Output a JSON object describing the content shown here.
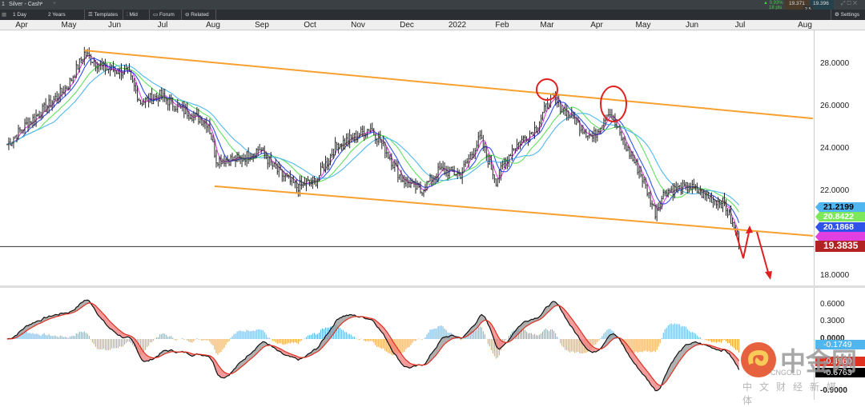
{
  "window": {
    "tab_number": "1",
    "title": "Silver - Cash",
    "quote": {
      "change_pct": "▲ 0.93%",
      "change_pts": "18 pts",
      "bid": "19.371",
      "ask": "19.396",
      "spread": "2.5"
    }
  },
  "toolbar": {
    "interval": "1 Day",
    "range": "2 Years",
    "templates": "Templates",
    "mid": "Mid",
    "forum": "Forum",
    "related": "Related",
    "settings": "Settings"
  },
  "colors": {
    "up_channel": "#f7a030",
    "price_line": "#b22222",
    "ma_fast": "#e040e0",
    "ma_mid": "#3050f0",
    "ma_slow": "#60e060",
    "ma_slower": "#50b8f0",
    "annotation": "#e02020"
  },
  "chart_data": [
    {
      "type": "candlestick",
      "title": "Silver - Cash",
      "x_ticks": [
        "Apr",
        "May",
        "Jun",
        "Jul",
        "Aug",
        "Sep",
        "Oct",
        "Nov",
        "Dec",
        "2022",
        "Feb",
        "Mar",
        "Apr",
        "May",
        "Jun",
        "Jul",
        "Aug"
      ],
      "y_ticks": [
        "28.0000",
        "26.0000",
        "24.0000",
        "22.0000",
        "18.0000"
      ],
      "ylim": [
        17.3,
        29.6
      ],
      "price_path": [
        [
          "2021-03-23",
          24.2
        ],
        [
          "2021-04-02",
          25.0
        ],
        [
          "2021-04-17",
          26.0
        ],
        [
          "2021-04-30",
          27.0
        ],
        [
          "2021-05-10",
          28.5
        ],
        [
          "2021-05-22",
          27.8
        ],
        [
          "2021-06-06",
          27.6
        ],
        [
          "2021-06-14",
          26.2
        ],
        [
          "2021-06-26",
          26.5
        ],
        [
          "2021-07-11",
          25.8
        ],
        [
          "2021-07-26",
          25.2
        ],
        [
          "2021-07-31",
          23.5
        ],
        [
          "2021-08-15",
          23.5
        ],
        [
          "2021-08-27",
          24.0
        ],
        [
          "2021-09-06",
          23.0
        ],
        [
          "2021-09-19",
          22.2
        ],
        [
          "2021-10-01",
          22.5
        ],
        [
          "2021-10-14",
          24.2
        ],
        [
          "2021-10-24",
          24.5
        ],
        [
          "2021-11-04",
          25.0
        ],
        [
          "2021-11-13",
          24.0
        ],
        [
          "2021-11-23",
          22.6
        ],
        [
          "2021-12-05",
          22.0
        ],
        [
          "2021-12-17",
          23.0
        ],
        [
          "2021-12-30",
          22.8
        ],
        [
          "2022-01-11",
          24.5
        ],
        [
          "2022-01-21",
          22.5
        ],
        [
          "2022-01-31",
          24.0
        ],
        [
          "2022-02-15",
          25.0
        ],
        [
          "2022-02-24",
          26.4
        ],
        [
          "2022-03-05",
          25.8
        ],
        [
          "2022-03-22",
          24.5
        ],
        [
          "2022-04-01",
          25.8
        ],
        [
          "2022-04-11",
          24.2
        ],
        [
          "2022-04-21",
          22.8
        ],
        [
          "2022-04-30",
          21.0
        ],
        [
          "2022-05-06",
          22.0
        ],
        [
          "2022-05-21",
          22.2
        ],
        [
          "2022-05-31",
          21.8
        ],
        [
          "2022-06-12",
          21.4
        ],
        [
          "2022-06-22",
          19.4
        ]
      ],
      "channel_upper": [
        [
          "2021-05-10",
          28.64
        ],
        [
          "2022-08-06",
          25.43
        ]
      ],
      "channel_lower": [
        [
          "2021-07-30",
          22.23
        ],
        [
          "2022-08-06",
          19.89
        ]
      ],
      "last_price": "19.3835",
      "ma_labels": [
        "21.2199",
        "20.8422",
        "20.1868"
      ],
      "annotations": [
        "circle at Mar 2022 high",
        "circle at Apr 2022 high",
        "red arrow up then down projection"
      ]
    },
    {
      "type": "macd",
      "y_ticks": [
        "0.6000",
        "0.3000",
        "0.0000",
        "-0.9000"
      ],
      "ylim": [
        -1.05,
        0.8
      ],
      "labels": [
        "-0.1749",
        "-0.4960",
        "-0.6763"
      ]
    }
  ],
  "watermark": {
    "logo": "中金网",
    "sub": "CNGOLD",
    "tag": "中 文 财 经 新 媒 体"
  }
}
